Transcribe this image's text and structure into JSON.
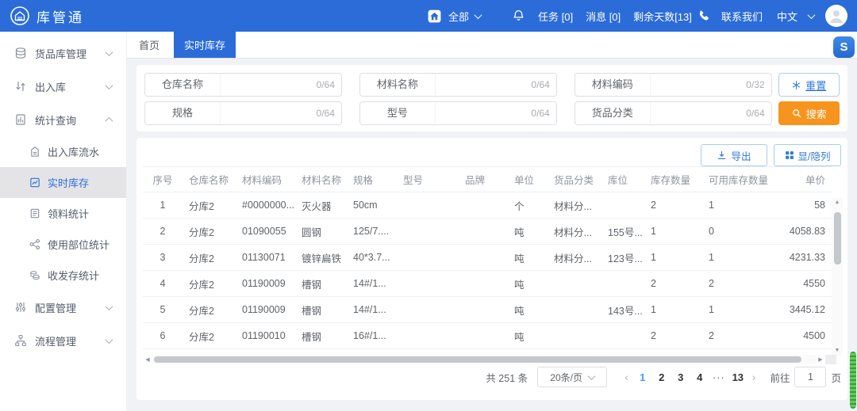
{
  "colors": {
    "header_blue": "#2b6cd9",
    "accent_blue": "#2f7cd4",
    "search_orange": "#f7941d",
    "active_page_blue": "#409eff",
    "edge_scrollbar_green": "#2f9e53"
  },
  "header": {
    "app_name": "库管通",
    "site_label": "全部",
    "tasks_label": "任务 [0]",
    "messages_label": "消息 [0]",
    "days_left_label": "剩余天数[13]",
    "contact_label": "联系我们",
    "language_label": "中文"
  },
  "sidebar": {
    "groups": [
      {
        "label": "货品库管理"
      },
      {
        "label": "出入库"
      },
      {
        "label": "统计查询"
      }
    ],
    "stats_children": [
      {
        "label": "出入库流水"
      },
      {
        "label": "实时库存"
      },
      {
        "label": "领料统计"
      },
      {
        "label": "使用部位统计"
      },
      {
        "label": "收发存统计"
      }
    ],
    "groups_bottom": [
      {
        "label": "配置管理"
      },
      {
        "label": "流程管理"
      }
    ]
  },
  "tabs": {
    "home": "首页",
    "current": "实时库存"
  },
  "search": {
    "fields": [
      {
        "label": "仓库名称",
        "counter": "0/64"
      },
      {
        "label": "材料名称",
        "counter": "0/64"
      },
      {
        "label": "材料编码",
        "counter": "0/32"
      },
      {
        "label": "规格",
        "counter": "0/64"
      },
      {
        "label": "型号",
        "counter": "0/64"
      },
      {
        "label": "货品分类",
        "counter": "0/64"
      }
    ],
    "reset_label": "重置",
    "search_label": "搜索"
  },
  "toolbar": {
    "export_label": "导出",
    "columns_label": "显/隐列"
  },
  "table": {
    "columns": [
      "序号",
      "仓库名称",
      "材料编码",
      "材料名称",
      "规格",
      "型号",
      "品牌",
      "单位",
      "货品分类",
      "库位",
      "库存数量",
      "可用库存数量",
      "单价"
    ],
    "rows": [
      [
        "1",
        "分库2",
        "#0000000...",
        "灭火器",
        "50cm",
        "",
        "",
        "个",
        "材料分...",
        "",
        "2",
        "1",
        "58"
      ],
      [
        "2",
        "分库2",
        "01090055",
        "圆钢",
        "125/7....",
        "",
        "",
        "吨",
        "材料分...",
        "155号...",
        "1",
        "0",
        "4058.83"
      ],
      [
        "3",
        "分库2",
        "01130071",
        "镀锌扁铁",
        "40*3.7...",
        "",
        "",
        "吨",
        "材料分...",
        "123号...",
        "1",
        "1",
        "4231.33"
      ],
      [
        "4",
        "分库2",
        "01190009",
        "槽钢",
        "14#/1...",
        "",
        "",
        "吨",
        "",
        "",
        "2",
        "2",
        "4550"
      ],
      [
        "5",
        "分库2",
        "01190009",
        "槽钢",
        "14#/1...",
        "",
        "",
        "吨",
        "",
        "143号...",
        "1",
        "1",
        "3445.12"
      ],
      [
        "6",
        "分库2",
        "01190010",
        "槽钢",
        "16#/1...",
        "",
        "",
        "吨",
        "",
        "",
        "2",
        "2",
        "4500"
      ]
    ]
  },
  "pagination": {
    "total_label": "共 251 条",
    "page_size_label": "20条/页",
    "pages": [
      "1",
      "2",
      "3",
      "4",
      "...",
      "13"
    ],
    "active_page": "1",
    "goto_label": "前往",
    "goto_value": "1",
    "unit_label": "页"
  },
  "widgets": {
    "service_badge": "S"
  }
}
